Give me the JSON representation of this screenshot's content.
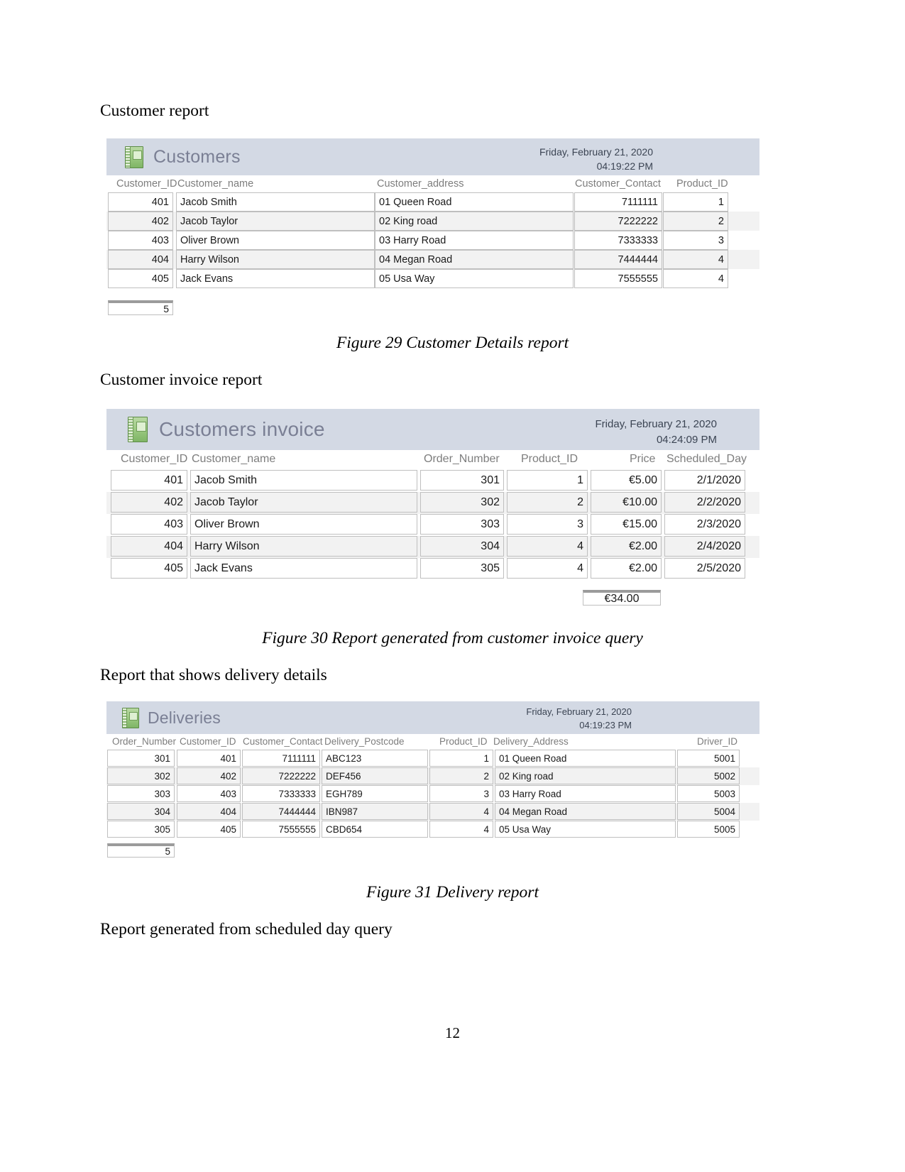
{
  "document": {
    "page_number": "12",
    "headings": {
      "customer_report": "Customer report",
      "customer_invoice_report": "Customer invoice report",
      "delivery_details_report": "Report that shows delivery details",
      "scheduled_day_report": "Report generated from scheduled day query"
    },
    "captions": {
      "figure29": "Figure 29 Customer Details report",
      "figure30": "Figure 30 Report generated from customer invoice query",
      "figure31": "Figure 31 Delivery report"
    }
  },
  "customers_report": {
    "icon": "notebook-report-icon",
    "title": "Customers",
    "date": "Friday, February 21, 2020",
    "time": "04:19:22 PM",
    "columns": [
      "Customer_ID",
      "Customer_name",
      "Customer_address",
      "Customer_Contact",
      "Product_ID"
    ],
    "rows": [
      {
        "customer_id": "401",
        "customer_name": "Jacob Smith",
        "customer_address": "01 Queen Road",
        "customer_contact": "7111111",
        "product_id": "1"
      },
      {
        "customer_id": "402",
        "customer_name": "Jacob Taylor",
        "customer_address": "02 King road",
        "customer_contact": "7222222",
        "product_id": "2"
      },
      {
        "customer_id": "403",
        "customer_name": "Oliver Brown",
        "customer_address": "03 Harry Road",
        "customer_contact": "7333333",
        "product_id": "3"
      },
      {
        "customer_id": "404",
        "customer_name": "Harry Wilson",
        "customer_address": "04 Megan Road",
        "customer_contact": "7444444",
        "product_id": "4"
      },
      {
        "customer_id": "405",
        "customer_name": "Jack Evans",
        "customer_address": "05 Usa Way",
        "customer_contact": "7555555",
        "product_id": "4"
      }
    ],
    "footer_total": "5"
  },
  "customers_invoice_report": {
    "icon": "notebook-report-icon",
    "title": "Customers invoice",
    "date": "Friday, February 21, 2020",
    "time": "04:24:09 PM",
    "columns": [
      "Customer_ID",
      "Customer_name",
      "Order_Number",
      "Product_ID",
      "Price",
      "Scheduled_Day"
    ],
    "rows": [
      {
        "customer_id": "401",
        "customer_name": "Jacob Smith",
        "order_number": "301",
        "product_id": "1",
        "price": "€5.00",
        "scheduled_day": "2/1/2020"
      },
      {
        "customer_id": "402",
        "customer_name": "Jacob Taylor",
        "order_number": "302",
        "product_id": "2",
        "price": "€10.00",
        "scheduled_day": "2/2/2020"
      },
      {
        "customer_id": "403",
        "customer_name": "Oliver Brown",
        "order_number": "303",
        "product_id": "3",
        "price": "€15.00",
        "scheduled_day": "2/3/2020"
      },
      {
        "customer_id": "404",
        "customer_name": "Harry Wilson",
        "order_number": "304",
        "product_id": "4",
        "price": "€2.00",
        "scheduled_day": "2/4/2020"
      },
      {
        "customer_id": "405",
        "customer_name": "Jack Evans",
        "order_number": "305",
        "product_id": "4",
        "price": "€2.00",
        "scheduled_day": "2/5/2020"
      }
    ],
    "footer_total": "€34.00"
  },
  "deliveries_report": {
    "icon": "notebook-report-icon",
    "title": "Deliveries",
    "date": "Friday, February 21, 2020",
    "time": "04:19:23 PM",
    "columns": [
      "Order_Number",
      "Customer_ID",
      "Customer_Contact",
      "Delivery_Postcode",
      "Product_ID",
      "Delivery_Address",
      "Driver_ID"
    ],
    "rows": [
      {
        "order_number": "301",
        "customer_id": "401",
        "customer_contact": "7111111",
        "delivery_postcode": "ABC123",
        "product_id": "1",
        "delivery_address": "01 Queen Road",
        "driver_id": "5001"
      },
      {
        "order_number": "302",
        "customer_id": "402",
        "customer_contact": "7222222",
        "delivery_postcode": "DEF456",
        "product_id": "2",
        "delivery_address": "02 King road",
        "driver_id": "5002"
      },
      {
        "order_number": "303",
        "customer_id": "403",
        "customer_contact": "7333333",
        "delivery_postcode": "EGH789",
        "product_id": "3",
        "delivery_address": "03 Harry Road",
        "driver_id": "5003"
      },
      {
        "order_number": "304",
        "customer_id": "404",
        "customer_contact": "7444444",
        "delivery_postcode": "IBN987",
        "product_id": "4",
        "delivery_address": "04 Megan Road",
        "driver_id": "5004"
      },
      {
        "order_number": "305",
        "customer_id": "405",
        "customer_contact": "7555555",
        "delivery_postcode": "CBD654",
        "product_id": "4",
        "delivery_address": "05 Usa Way",
        "driver_id": "5005"
      }
    ],
    "footer_total": "5"
  },
  "colors": {
    "header_band": "#d3d9e4",
    "header_title_text": "#7a7f94",
    "column_header_text": "#7d7d7d",
    "alt_row": "#f2f2f2",
    "cell_border": "#bfbfbf",
    "icon_green": "#9ecb84"
  }
}
